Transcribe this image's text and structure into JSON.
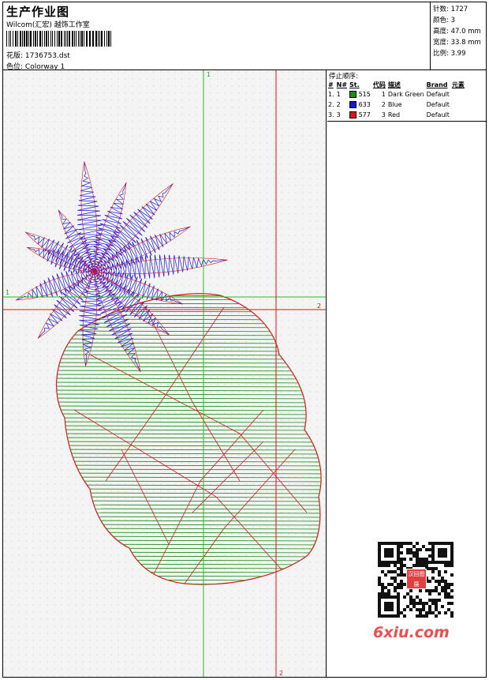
{
  "header": {
    "title": "生产作业图",
    "studio": "Wilcom(汇宏) 越饰工作室",
    "file_label": "花版:",
    "file_name": "1736753.dst",
    "colorway_label": "色位:",
    "colorway": "Colorway 1"
  },
  "stats": {
    "stitches": "针数: 1727",
    "colors": "颜色: 3",
    "height": "高度: 47.0 mm",
    "width": "宽度: 33.8 mm",
    "scale": "比例: 3.99"
  },
  "stop_sequence": {
    "title": "停止顺序:",
    "columns": [
      "#",
      "N#",
      "St.",
      "代码",
      "描述",
      "Brand",
      "元素"
    ],
    "rows": [
      {
        "num": "1.",
        "n": "1",
        "st": "515",
        "code": "1",
        "desc": "Dark Green",
        "brand": "Default",
        "color": "#1a8c1a"
      },
      {
        "num": "2.",
        "n": "2",
        "st": "633",
        "code": "2",
        "desc": "Blue",
        "brand": "Default",
        "color": "#1515e6"
      },
      {
        "num": "3.",
        "n": "3",
        "st": "577",
        "code": "3",
        "desc": "Red",
        "brand": "Default",
        "color": "#e01515"
      }
    ]
  },
  "guides": {
    "v1_top": "1",
    "h1_left": "1",
    "h2_right": "2",
    "v2_bottom": "2"
  },
  "watermark": "6xiu.com",
  "qr_stamp": "汉回图展"
}
